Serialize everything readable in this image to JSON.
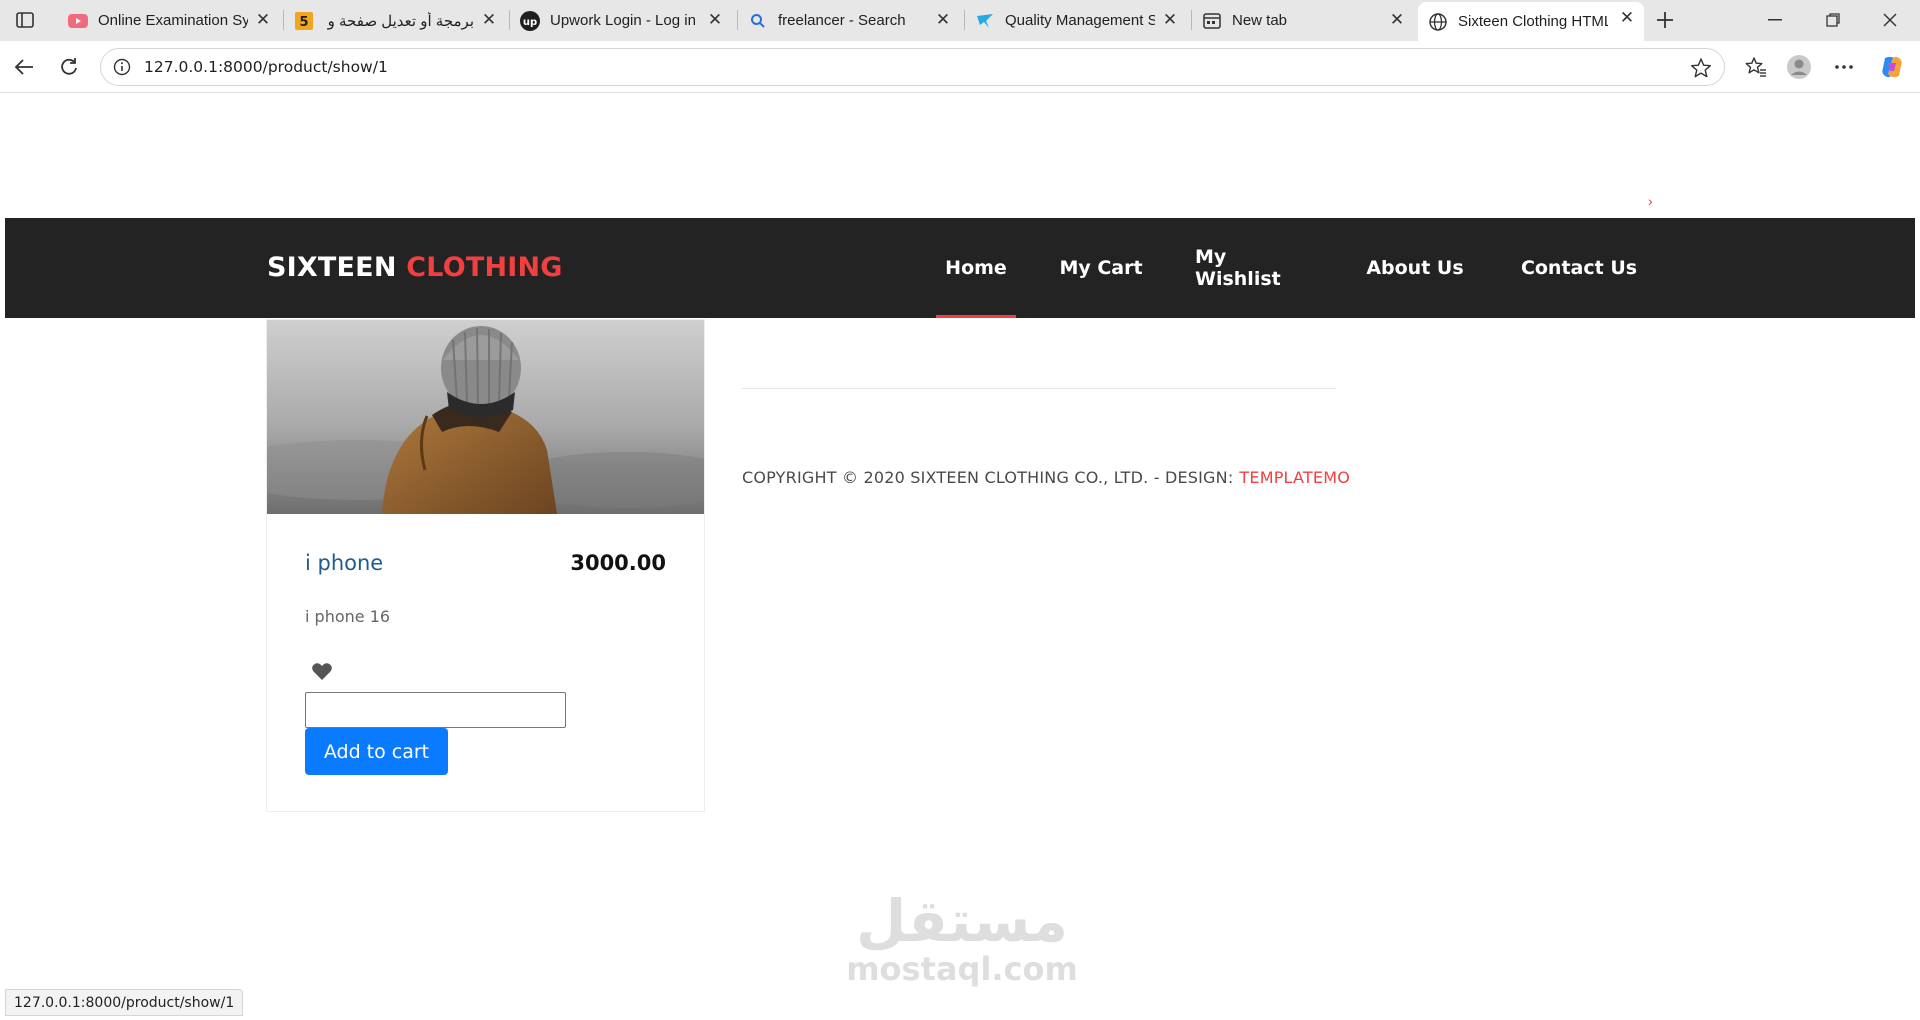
{
  "browser": {
    "tabs": [
      {
        "title": "Online Examination System",
        "icon": "youtube-icon"
      },
      {
        "title": "برمجة أو تعديل صفحة و",
        "icon": "number-5-icon"
      },
      {
        "title": "Upwork Login - Log in",
        "icon": "upwork-icon"
      },
      {
        "title": "freelancer - Search",
        "icon": "search-icon"
      },
      {
        "title": "Quality Management S",
        "icon": "freelancer-icon"
      },
      {
        "title": "New tab",
        "icon": "new-tab-icon"
      },
      {
        "title": "Sixteen Clothing HTML",
        "icon": "globe-icon"
      }
    ],
    "url": "127.0.0.1:8000/product/show/1",
    "status_url": "127.0.0.1:8000/product/show/1"
  },
  "site": {
    "logo_part1": "SIXTEEN",
    "logo_part2": "CLOTHING",
    "nav": [
      {
        "label": "Home",
        "active": true
      },
      {
        "label": "My Cart",
        "active": false
      },
      {
        "label": "My Wishlist",
        "active": false
      },
      {
        "label": "About Us",
        "active": false
      },
      {
        "label": "Contact Us",
        "active": false
      }
    ],
    "slider_arrow": "›"
  },
  "product": {
    "name": "i phone",
    "price": "3000.00",
    "description": "i phone 16",
    "quantity_value": "",
    "add_to_cart_label": "Add to cart"
  },
  "footer": {
    "copyright": "COPYRIGHT © 2020 SIXTEEN CLOTHING CO., LTD. - DESIGN:",
    "design_link": "TEMPLATEMO"
  },
  "watermark": {
    "arabic": "مستقل",
    "latin": "mostaql.com"
  },
  "colors": {
    "accent": "#f33f3f",
    "header_bg": "#232323",
    "button_blue": "#0a7bff",
    "product_name": "#1e5c91"
  }
}
